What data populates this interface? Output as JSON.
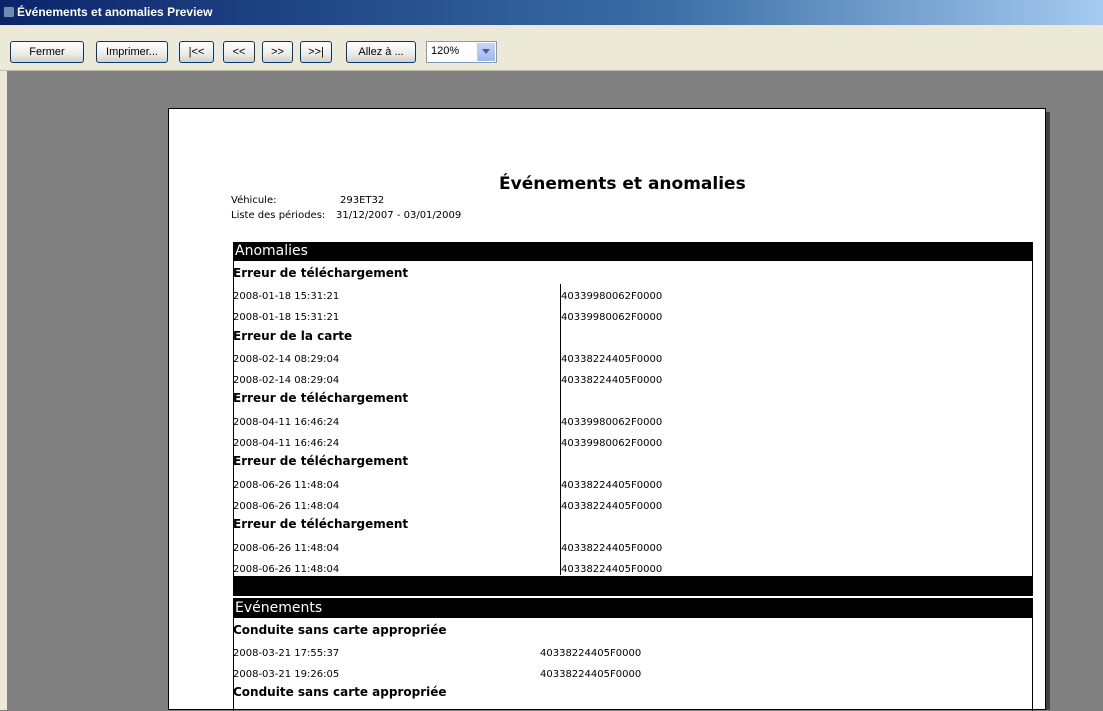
{
  "window": {
    "title": "Événements et anomalies Preview"
  },
  "toolbar": {
    "close_label": "Fermer",
    "print_label": "Imprimer...",
    "first_label": "|<<",
    "prev_label": "<<",
    "next_label": ">>",
    "last_label": ">>|",
    "goto_label": "Allez à ...",
    "zoom_value": "120%"
  },
  "report": {
    "title": "Événements et anomalies",
    "vehicle_label": "Véhicule:",
    "vehicle_value": "293ET32",
    "periods_label": "Liste des périodes:",
    "periods_value": "31/12/2007 - 03/01/2009"
  },
  "anomalies": {
    "header": "Anomalies",
    "groups": [
      {
        "title": "Erreur de téléchargement",
        "rows": [
          {
            "date": "2008-01-18 15:31:21",
            "id": "40339980062F0000"
          },
          {
            "date": "2008-01-18 15:31:21",
            "id": "40339980062F0000"
          }
        ]
      },
      {
        "title": "Erreur de la carte",
        "rows": [
          {
            "date": "2008-02-14 08:29:04",
            "id": "40338224405F0000"
          },
          {
            "date": "2008-02-14 08:29:04",
            "id": "40338224405F0000"
          }
        ]
      },
      {
        "title": "Erreur de téléchargement",
        "rows": [
          {
            "date": "2008-04-11 16:46:24",
            "id": "40339980062F0000"
          },
          {
            "date": "2008-04-11 16:46:24",
            "id": "40339980062F0000"
          }
        ]
      },
      {
        "title": "Erreur de téléchargement",
        "rows": [
          {
            "date": "2008-06-26 11:48:04",
            "id": "40338224405F0000"
          },
          {
            "date": "2008-06-26 11:48:04",
            "id": "40338224405F0000"
          }
        ]
      },
      {
        "title": "Erreur de téléchargement",
        "rows": [
          {
            "date": "2008-06-26 11:48:04",
            "id": "40338224405F0000"
          },
          {
            "date": "2008-06-26 11:48:04",
            "id": "40338224405F0000"
          }
        ]
      }
    ]
  },
  "events": {
    "header": "Evénements",
    "groups": [
      {
        "title": "Conduite sans carte appropriée",
        "rows": [
          {
            "date": "2008-03-21 17:55:37",
            "id": "40338224405F0000"
          },
          {
            "date": "2008-03-21 19:26:05",
            "id": "40338224405F0000"
          }
        ]
      },
      {
        "title": "Conduite sans carte appropriée",
        "rows": []
      }
    ]
  }
}
